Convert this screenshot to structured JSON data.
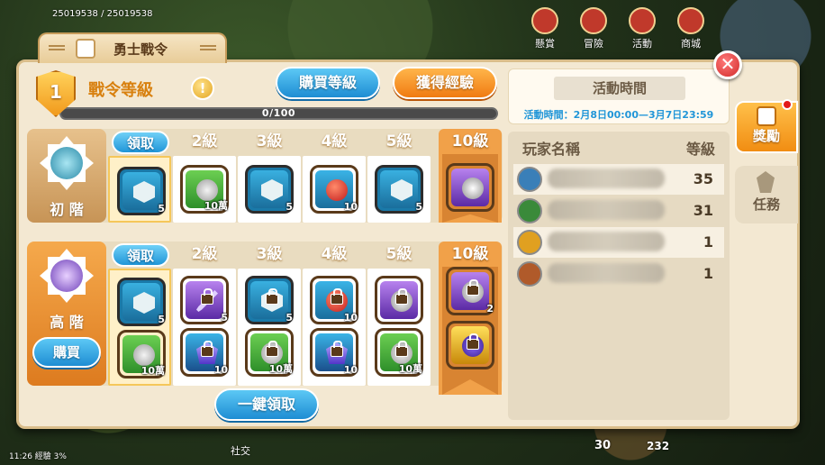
{
  "hud": {
    "resources": "25019538 / 25019538",
    "menu": [
      {
        "label": "懸賞"
      },
      {
        "label": "冒險"
      },
      {
        "label": "活動"
      },
      {
        "label": "商城"
      }
    ],
    "bottom_status": "11:26  經驗  3%",
    "social_label": "社交",
    "count_a": "30",
    "count_b": "232"
  },
  "window": {
    "title": "勇士戰令",
    "close_label": "✕"
  },
  "header": {
    "current_level": "1",
    "level_title": "戰令等級",
    "info_label": "!",
    "buy_level_label": "購買等級",
    "gain_exp_label": "獲得經驗",
    "progress_text": "0/100",
    "progress_fraction": 0.0
  },
  "tracks": {
    "column_headers": [
      "領取",
      "2級",
      "3級",
      "4級",
      "5級"
    ],
    "final_header": "10級",
    "basic": {
      "label": "初 階",
      "rewards": [
        {
          "type": "cube",
          "qty": "5"
        },
        {
          "type": "coin",
          "qty": "10萬"
        },
        {
          "type": "cube",
          "qty": "5"
        },
        {
          "type": "ball",
          "qty": "10"
        },
        {
          "type": "cube",
          "qty": "5"
        }
      ],
      "final": {
        "type": "silver",
        "qty": ""
      }
    },
    "advanced": {
      "label": "高 階",
      "buy_label": "購買",
      "rewards_top": [
        {
          "type": "cube",
          "qty": "5"
        },
        {
          "type": "sword",
          "qty": "5"
        },
        {
          "type": "cube",
          "qty": "5"
        },
        {
          "type": "ball",
          "qty": "10"
        },
        {
          "type": "silver",
          "qty": ""
        }
      ],
      "rewards_bottom": [
        {
          "type": "coin",
          "qty": "10萬"
        },
        {
          "type": "gem",
          "qty": "10"
        },
        {
          "type": "coin",
          "qty": "10萬"
        },
        {
          "type": "gem",
          "qty": "10"
        },
        {
          "type": "coin",
          "qty": "10萬"
        }
      ],
      "final_top": {
        "type": "silver",
        "qty": "2"
      },
      "final_bottom": {
        "type": "gold",
        "qty": ""
      }
    },
    "one_click_label": "一鍵領取"
  },
  "event": {
    "title": "活動時間",
    "time_text": "活動時間：2月8日00:00—3月7日23:59"
  },
  "ranking": {
    "col_name": "玩家名稱",
    "col_level": "等級",
    "rows": [
      {
        "level": "35",
        "avatar_color": "#3a7fb8"
      },
      {
        "level": "31",
        "avatar_color": "#3a8a3a"
      },
      {
        "level": "1",
        "avatar_color": "#e0a020"
      },
      {
        "level": "1",
        "avatar_color": "#b05a2a"
      }
    ]
  },
  "side_tabs": {
    "reward": "獎勵",
    "task": "任務"
  },
  "colors": {
    "accent_orange": "#f07b12",
    "accent_blue": "#1e8dd3",
    "panel_bg": "#f3e8d2"
  }
}
